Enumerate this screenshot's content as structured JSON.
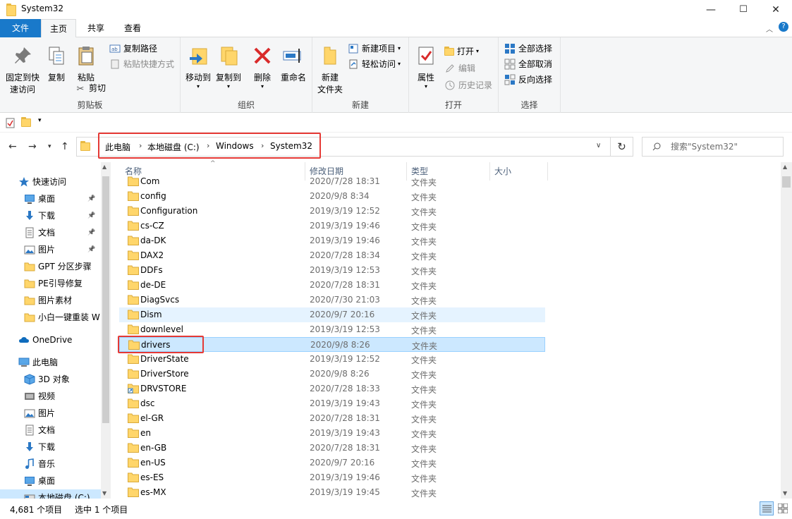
{
  "window": {
    "title": "System32",
    "minimize": "—",
    "maximize": "☐",
    "close": "✕"
  },
  "tabs": {
    "file": "文件",
    "home": "主页",
    "share": "共享",
    "view": "查看"
  },
  "ribbon": {
    "clipboard": {
      "label": "剪贴板",
      "pin": "固定到快速访问",
      "copy": "复制",
      "paste": "粘贴",
      "copy_path": "复制路径",
      "paste_shortcut": "粘贴快捷方式",
      "cut": "剪切"
    },
    "organize": {
      "label": "组织",
      "move_to": "移动到",
      "copy_to": "复制到",
      "delete": "删除",
      "rename": "重命名"
    },
    "new": {
      "label": "新建",
      "new_folder": "新建\n文件夹",
      "new_item": "新建项目",
      "easy_access": "轻松访问"
    },
    "open": {
      "label": "打开",
      "properties": "属性",
      "open": "打开",
      "edit": "编辑",
      "history": "历史记录"
    },
    "select": {
      "label": "选择",
      "select_all": "全部选择",
      "select_none": "全部取消",
      "invert": "反向选择"
    }
  },
  "address": {
    "crumbs": [
      "此电脑",
      "本地磁盘 (C:)",
      "Windows",
      "System32"
    ],
    "search_placeholder": "搜索\"System32\""
  },
  "sidebar": {
    "items": [
      {
        "label": "快速访问",
        "icon": "star-icon",
        "pinned": false
      },
      {
        "label": "桌面",
        "icon": "desktop-icon",
        "pinned": true
      },
      {
        "label": "下载",
        "icon": "download-icon",
        "pinned": true
      },
      {
        "label": "文档",
        "icon": "document-icon",
        "pinned": true
      },
      {
        "label": "图片",
        "icon": "pictures-icon",
        "pinned": true
      },
      {
        "label": "GPT 分区步骤",
        "icon": "folder-icon",
        "pinned": false
      },
      {
        "label": "PE引导修复",
        "icon": "folder-icon",
        "pinned": false
      },
      {
        "label": "图片素材",
        "icon": "folder-icon",
        "pinned": false
      },
      {
        "label": "小白一键重装 W",
        "icon": "folder-icon",
        "pinned": false
      },
      {
        "label": "OneDrive",
        "icon": "cloud-icon",
        "pinned": false
      },
      {
        "label": "此电脑",
        "icon": "computer-icon",
        "pinned": false
      },
      {
        "label": "3D 对象",
        "icon": "cube-icon",
        "pinned": false
      },
      {
        "label": "视频",
        "icon": "video-icon",
        "pinned": false
      },
      {
        "label": "图片",
        "icon": "pictures-icon",
        "pinned": false
      },
      {
        "label": "文档",
        "icon": "document-icon",
        "pinned": false
      },
      {
        "label": "下载",
        "icon": "download-icon",
        "pinned": false
      },
      {
        "label": "音乐",
        "icon": "music-icon",
        "pinned": false
      },
      {
        "label": "桌面",
        "icon": "desktop-icon",
        "pinned": false
      },
      {
        "label": "本地磁盘 (C:)",
        "icon": "drive-icon",
        "pinned": false
      }
    ]
  },
  "columns": {
    "name": "名称",
    "modified": "修改日期",
    "type": "类型",
    "size": "大小"
  },
  "files": [
    {
      "name": "Com",
      "date": "2020/7/28 18:31",
      "type": "文件夹"
    },
    {
      "name": "config",
      "date": "2020/9/8 8:34",
      "type": "文件夹"
    },
    {
      "name": "Configuration",
      "date": "2019/3/19 12:52",
      "type": "文件夹"
    },
    {
      "name": "cs-CZ",
      "date": "2019/3/19 19:46",
      "type": "文件夹"
    },
    {
      "name": "da-DK",
      "date": "2019/3/19 19:46",
      "type": "文件夹"
    },
    {
      "name": "DAX2",
      "date": "2020/7/28 18:34",
      "type": "文件夹"
    },
    {
      "name": "DDFs",
      "date": "2019/3/19 12:53",
      "type": "文件夹"
    },
    {
      "name": "de-DE",
      "date": "2020/7/28 18:31",
      "type": "文件夹"
    },
    {
      "name": "DiagSvcs",
      "date": "2020/7/30 21:03",
      "type": "文件夹"
    },
    {
      "name": "Dism",
      "date": "2020/9/7 20:16",
      "type": "文件夹"
    },
    {
      "name": "downlevel",
      "date": "2019/3/19 12:53",
      "type": "文件夹"
    },
    {
      "name": "drivers",
      "date": "2020/9/8 8:26",
      "type": "文件夹"
    },
    {
      "name": "DriverState",
      "date": "2019/3/19 12:52",
      "type": "文件夹"
    },
    {
      "name": "DriverStore",
      "date": "2020/9/8 8:26",
      "type": "文件夹"
    },
    {
      "name": "DRVSTORE",
      "date": "2020/7/28 18:33",
      "type": "文件夹"
    },
    {
      "name": "dsc",
      "date": "2019/3/19 19:43",
      "type": "文件夹"
    },
    {
      "name": "el-GR",
      "date": "2020/7/28 18:31",
      "type": "文件夹"
    },
    {
      "name": "en",
      "date": "2019/3/19 19:43",
      "type": "文件夹"
    },
    {
      "name": "en-GB",
      "date": "2020/7/28 18:31",
      "type": "文件夹"
    },
    {
      "name": "en-US",
      "date": "2020/9/7 20:16",
      "type": "文件夹"
    },
    {
      "name": "es-ES",
      "date": "2019/3/19 19:46",
      "type": "文件夹"
    },
    {
      "name": "es-MX",
      "date": "2019/3/19 19:45",
      "type": "文件夹"
    }
  ],
  "status": {
    "count": "4,681 个项目",
    "selected": "选中 1 个项目"
  },
  "colors": {
    "accent": "#1979ca",
    "highlight": "#e53935",
    "selection": "#cce8ff"
  }
}
